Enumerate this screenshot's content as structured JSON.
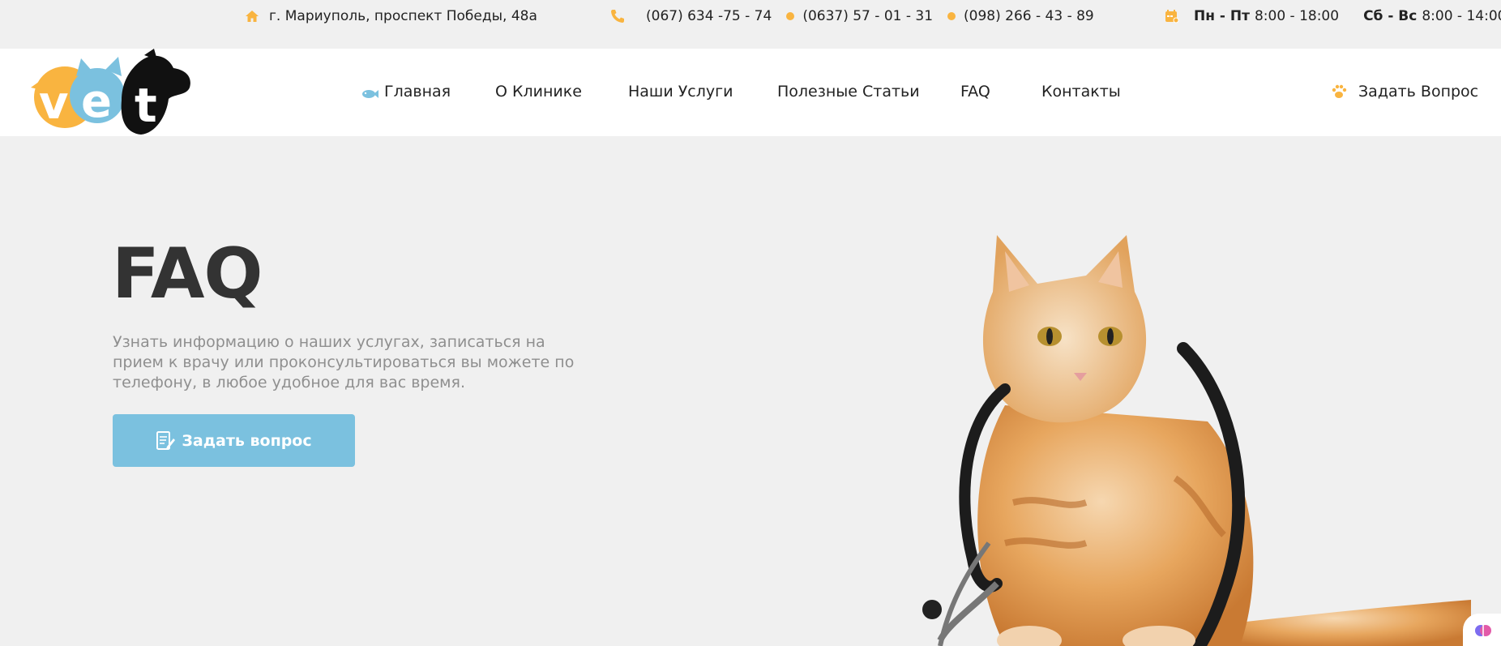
{
  "topbar": {
    "address": "г. Мариуполь, проспект Победы, 48а",
    "phones": [
      "(067) 634 -75 - 74",
      "(0637) 57 - 01 - 31",
      "(098) 266 - 43 - 89"
    ],
    "hours": [
      {
        "days": "Пн - Пт",
        "time": "8:00 - 18:00"
      },
      {
        "days": "Сб - Вс",
        "time": "8:00 - 14:00"
      }
    ]
  },
  "logo": {
    "text": "vet"
  },
  "nav": {
    "items": [
      "Главная",
      "О Клинике",
      "Наши Услуги",
      "Полезные Статьи",
      "FAQ",
      "Контакты"
    ],
    "ask": "Задать Вопрос"
  },
  "hero": {
    "title": "FAQ",
    "text": "Узнать информацию о наших услугах, записаться на прием к врачу или проконсультироваться вы можете по телефону, в любое удобное для вас время.",
    "button": "Задать вопрос"
  },
  "colors": {
    "accent": "#f9b440",
    "blue": "#7bc1df",
    "dark": "#333333"
  },
  "icons": [
    "home-icon",
    "phone-icon",
    "calendar-icon",
    "fish-icon",
    "paw-icon",
    "note-icon",
    "brain-icon"
  ]
}
